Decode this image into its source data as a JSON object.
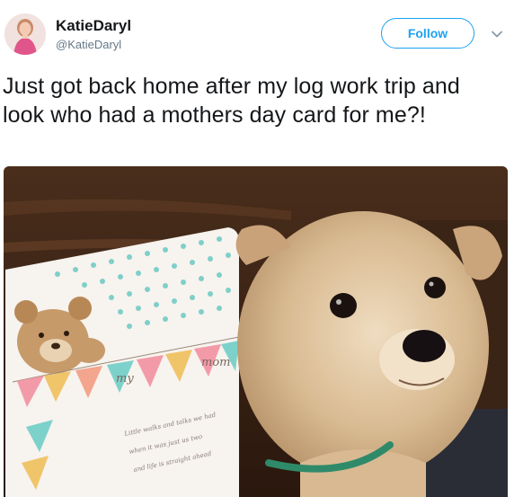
{
  "user": {
    "display_name": "KatieDaryl",
    "handle": "@KatieDaryl",
    "avatar_icon": "profile-photo"
  },
  "follow_button": {
    "label": "Follow",
    "color": "#1da1f2"
  },
  "menu": {
    "icon": "chevron-down-icon"
  },
  "tweet": {
    "text": "Just got back home after my log work trip and look who had a mothers day card for me?!"
  },
  "photo": {
    "card_banner_letters": [
      "m",
      "y",
      "m",
      "o",
      "m"
    ],
    "card_text": [
      "Little walks and talks we had",
      "when it was just us two",
      "and life is straight ahead"
    ]
  }
}
